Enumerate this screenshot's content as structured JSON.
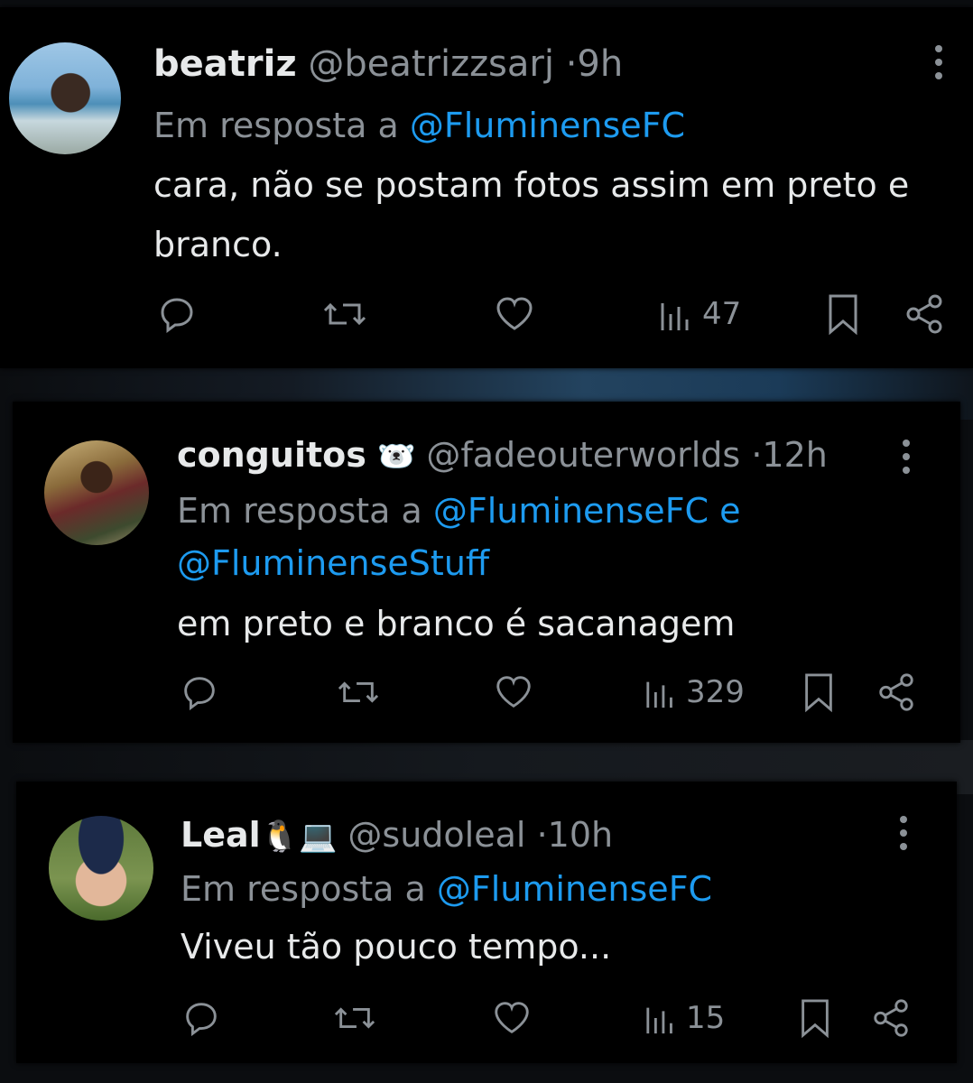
{
  "tweets": [
    {
      "name": "beatriz",
      "name_emoji": "",
      "handle": "@beatrizzsarj",
      "time": "9h",
      "reply_prefix": "Em resposta a",
      "reply_to": "@FluminenseFC",
      "reply_joiner": "",
      "reply_to_2": "",
      "text": "cara, não se postam fotos assim em preto e branco.",
      "views": "47"
    },
    {
      "name": "conguitos",
      "name_emoji": "🐻‍❄️",
      "handle": "@fadeouterworlds",
      "time": "12h",
      "reply_prefix": "Em resposta a",
      "reply_to": "@FluminenseFC",
      "reply_joiner": "e",
      "reply_to_2": "@FluminenseStuff",
      "text": "em preto e branco é sacanagem",
      "views": "329"
    },
    {
      "name": "Leal",
      "name_emoji": "🐧💻",
      "handle": "@sudoleal",
      "time": "10h",
      "reply_prefix": "Em resposta a",
      "reply_to": "@FluminenseFC",
      "reply_joiner": "",
      "reply_to_2": "",
      "text": "Viveu tão pouco tempo...",
      "views": "15"
    }
  ],
  "separator": "·",
  "icons": {
    "reply": "comment-icon",
    "retweet": "retweet-icon",
    "like": "heart-icon",
    "views": "bar-chart-icon",
    "bookmark": "bookmark-icon",
    "share": "share-icon",
    "more": "more-vertical-icon"
  },
  "colors": {
    "background": "#000000",
    "text": "#e7e9ea",
    "secondary": "#8b9197",
    "link": "#1d9bf0"
  }
}
